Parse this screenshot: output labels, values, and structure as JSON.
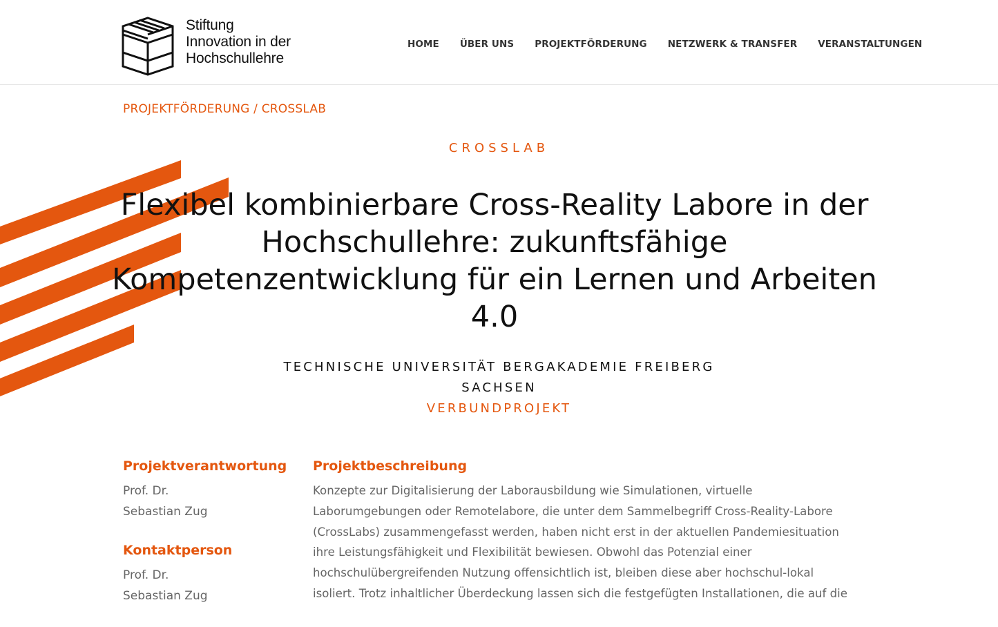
{
  "logo": {
    "lines": [
      "Stiftung",
      "Innovation in der",
      "Hochschullehre"
    ]
  },
  "nav": {
    "items": [
      "HOME",
      "ÜBER UNS",
      "PROJEKTFÖRDERUNG",
      "NETZWERK & TRANSFER",
      "VERANSTALTUNGEN"
    ]
  },
  "breadcrumb": {
    "parent": "PROJEKTFÖRDERUNG",
    "separator": " / ",
    "current": "CROSSLAB"
  },
  "hero": {
    "category": "CROSSLAB",
    "title": "Flexibel kombinierbare Cross-Reality Labore in der Hochschullehre: zukunftsfähige Kompetenzentwicklung für ein Lernen und Arbeiten 4.0",
    "university": "TECHNISCHE UNIVERSITÄT BERGAKADEMIE FREIBERG",
    "state": "SACHSEN",
    "project_type": "VERBUNDPROJEKT"
  },
  "sidebar": {
    "responsible_heading": "Projektverantwortung",
    "responsible_title": "Prof. Dr.",
    "responsible_name": "Sebastian Zug",
    "contact_heading": "Kontaktperson",
    "contact_title": "Prof. Dr.",
    "contact_name": "Sebastian Zug"
  },
  "description": {
    "heading": "Projektbeschreibung",
    "text": "Konzepte zur Digitalisierung der Laborausbildung wie Simulationen, virtuelle Laborumgebungen oder Remotelabore, die unter dem Sammelbegriff Cross-Reality-Labore (CrossLabs) zusammengefasst werden, haben nicht erst in der aktuellen Pandemiesituation ihre Leistungsfähigkeit und Flexibilität bewiesen. Obwohl das Potenzial einer hochschulübergreifenden Nutzung offensichtlich ist, bleiben diese aber hochschul-lokal isoliert. Trotz inhaltlicher Überdeckung lassen sich die festgefügten Installationen, die auf die"
  },
  "colors": {
    "accent": "#e4570f",
    "text": "#111111",
    "muted": "#666666"
  }
}
